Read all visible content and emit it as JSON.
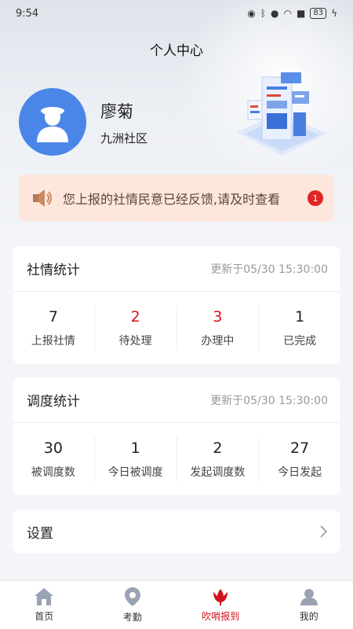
{
  "status_bar": {
    "time": "9:54",
    "battery": "83"
  },
  "header": {
    "title": "个人中心"
  },
  "user": {
    "name": "廖菊",
    "org": "九洲社区",
    "avatar_icon": "user-avatar-icon"
  },
  "notice": {
    "text": "您上报的社情民意已经反馈,请及时查看",
    "badge": "1"
  },
  "social_stats": {
    "title": "社情统计",
    "updated": "更新于05/30 15:30:00",
    "items": [
      {
        "value": "7",
        "label": "上报社情",
        "color": "#222222"
      },
      {
        "value": "2",
        "label": "待处理",
        "color": "#d0121b"
      },
      {
        "value": "3",
        "label": "办理中",
        "color": "#d0121b"
      },
      {
        "value": "1",
        "label": "已完成",
        "color": "#222222"
      }
    ]
  },
  "dispatch_stats": {
    "title": "调度统计",
    "updated": "更新于05/30 15:30:00",
    "items": [
      {
        "value": "30",
        "label": "被调度数"
      },
      {
        "value": "1",
        "label": "今日被调度"
      },
      {
        "value": "2",
        "label": "发起调度数"
      },
      {
        "value": "27",
        "label": "今日发起"
      }
    ]
  },
  "settings": {
    "label": "设置"
  },
  "tabbar": {
    "items": [
      {
        "label": "首页",
        "icon": "home-icon"
      },
      {
        "label": "考勤",
        "icon": "location-pin-icon"
      },
      {
        "label": "吹哨报到",
        "icon": "tulip-icon",
        "active": true
      },
      {
        "label": "我的",
        "icon": "profile-icon"
      }
    ]
  },
  "colors": {
    "accent": "#d0121b",
    "avatar_bg": "#4a86e8",
    "notice_bg": "#fde6dc"
  }
}
